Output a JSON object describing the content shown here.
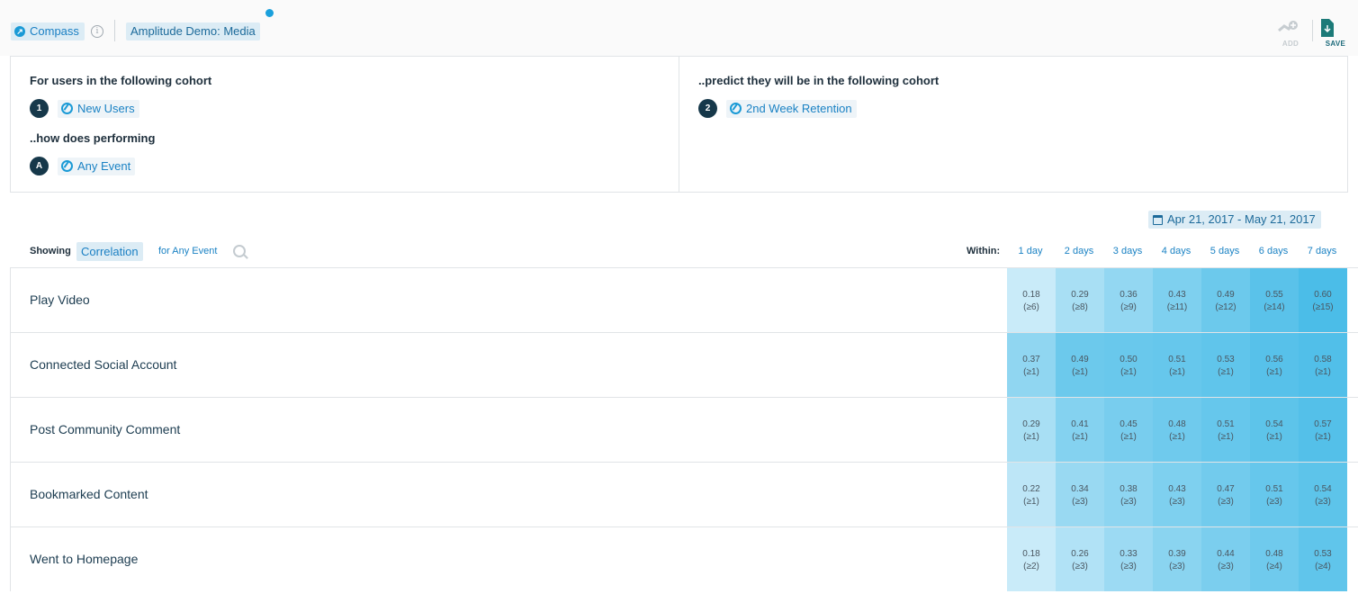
{
  "header": {
    "app_label": "Compass",
    "info_glyph": "i",
    "project_label": "Amplitude Demo: Media",
    "add_label": "ADD",
    "save_label": "SAVE"
  },
  "cohorts": {
    "left_heading": "For users in the following cohort",
    "cohort_1_badge": "1",
    "cohort_1_name": "New Users",
    "performing_heading": "..how does performing",
    "event_badge": "A",
    "event_name": "Any Event",
    "right_heading": "..predict they will be in the following cohort",
    "cohort_2_badge": "2",
    "cohort_2_name": "2nd Week Retention"
  },
  "controls": {
    "date_range": "Apr 21, 2017 - May 21, 2017",
    "showing_label": "Showing",
    "metric": "Correlation",
    "for_label": "for Any Event",
    "within_label": "Within:"
  },
  "columns": [
    "1 day",
    "2 days",
    "3 days",
    "4 days",
    "5 days",
    "6 days",
    "7 days"
  ],
  "rows": [
    {
      "name": "Play Video",
      "cells": [
        {
          "v": "0.18",
          "c": "(≥6)"
        },
        {
          "v": "0.29",
          "c": "(≥8)"
        },
        {
          "v": "0.36",
          "c": "(≥9)"
        },
        {
          "v": "0.43",
          "c": "(≥11)"
        },
        {
          "v": "0.49",
          "c": "(≥12)"
        },
        {
          "v": "0.55",
          "c": "(≥14)"
        },
        {
          "v": "0.60",
          "c": "(≥15)"
        }
      ]
    },
    {
      "name": "Connected Social Account",
      "cells": [
        {
          "v": "0.37",
          "c": "(≥1)"
        },
        {
          "v": "0.49",
          "c": "(≥1)"
        },
        {
          "v": "0.50",
          "c": "(≥1)"
        },
        {
          "v": "0.51",
          "c": "(≥1)"
        },
        {
          "v": "0.53",
          "c": "(≥1)"
        },
        {
          "v": "0.56",
          "c": "(≥1)"
        },
        {
          "v": "0.58",
          "c": "(≥1)"
        }
      ]
    },
    {
      "name": "Post Community Comment",
      "cells": [
        {
          "v": "0.29",
          "c": "(≥1)"
        },
        {
          "v": "0.41",
          "c": "(≥1)"
        },
        {
          "v": "0.45",
          "c": "(≥1)"
        },
        {
          "v": "0.48",
          "c": "(≥1)"
        },
        {
          "v": "0.51",
          "c": "(≥1)"
        },
        {
          "v": "0.54",
          "c": "(≥1)"
        },
        {
          "v": "0.57",
          "c": "(≥1)"
        }
      ]
    },
    {
      "name": "Bookmarked Content",
      "cells": [
        {
          "v": "0.22",
          "c": "(≥1)"
        },
        {
          "v": "0.34",
          "c": "(≥3)"
        },
        {
          "v": "0.38",
          "c": "(≥3)"
        },
        {
          "v": "0.43",
          "c": "(≥3)"
        },
        {
          "v": "0.47",
          "c": "(≥3)"
        },
        {
          "v": "0.51",
          "c": "(≥3)"
        },
        {
          "v": "0.54",
          "c": "(≥3)"
        }
      ]
    },
    {
      "name": "Went to Homepage",
      "cells": [
        {
          "v": "0.18",
          "c": "(≥2)"
        },
        {
          "v": "0.26",
          "c": "(≥3)"
        },
        {
          "v": "0.33",
          "c": "(≥3)"
        },
        {
          "v": "0.39",
          "c": "(≥3)"
        },
        {
          "v": "0.44",
          "c": "(≥3)"
        },
        {
          "v": "0.48",
          "c": "(≥4)"
        },
        {
          "v": "0.53",
          "c": "(≥4)"
        }
      ]
    }
  ],
  "colors": {
    "accent": "#1a82c4",
    "heat_low": "#d2eefa",
    "heat_high": "#4bbde8",
    "badge": "#16384a"
  }
}
